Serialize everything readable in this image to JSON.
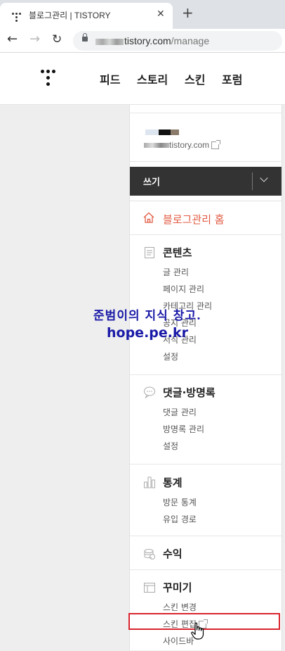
{
  "browser": {
    "tab_title": "블로그관리 | TISTORY",
    "tab_close": "✕",
    "new_tab": "+",
    "url_domain": "tistory.com",
    "url_path": "/manage"
  },
  "header": {
    "nav": [
      "피드",
      "스토리",
      "스킨",
      "포럼"
    ]
  },
  "blog": {
    "url": "tistory.com"
  },
  "write": {
    "label": "쓰기"
  },
  "menu": {
    "home": "블로그관리 홈",
    "content": {
      "title": "콘텐츠",
      "items": [
        "글 관리",
        "페이지 관리",
        "카테고리 관리",
        "공지 관리",
        "서식 관리",
        "설정"
      ]
    },
    "comments": {
      "title": "댓글·방명록",
      "items": [
        "댓글 관리",
        "방명록 관리",
        "설정"
      ]
    },
    "stats": {
      "title": "통계",
      "items": [
        "방문 통계",
        "유입 경로"
      ]
    },
    "revenue": {
      "title": "수익"
    },
    "decorate": {
      "title": "꾸미기",
      "items": [
        "스킨 변경",
        "스킨 편집",
        "사이드바"
      ]
    }
  },
  "watermark": {
    "line1": "준범이의 지식 창고.",
    "line2": "hope.pe.kr"
  },
  "colors": {
    "accent": "#e25a41",
    "write_bg": "#333333",
    "highlight": "#d9252e",
    "watermark": "#1a1aa8"
  }
}
